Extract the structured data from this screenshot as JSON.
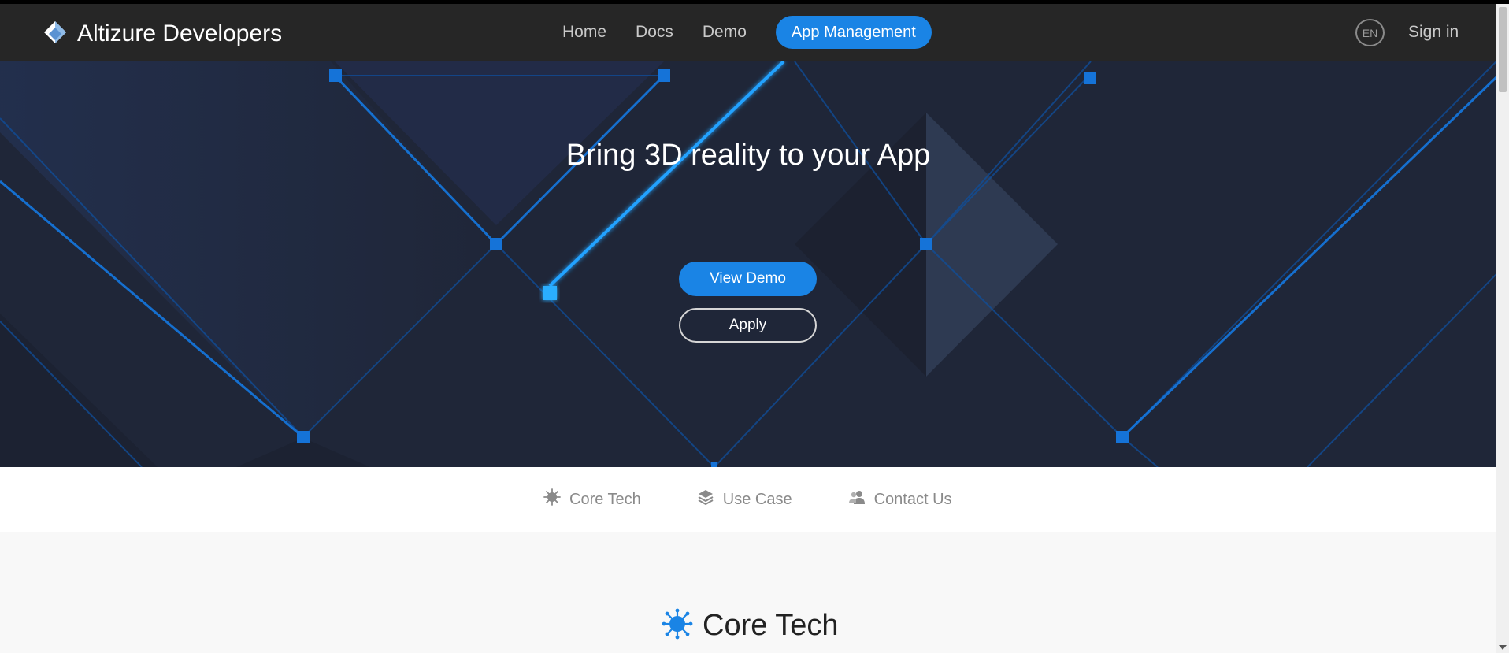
{
  "navbar": {
    "brand": "Altizure Developers",
    "links": [
      "Home",
      "Docs",
      "Demo"
    ],
    "app_management": "App Management",
    "lang": "EN",
    "sign_in": "Sign in"
  },
  "hero": {
    "title": "Bring 3D reality to your App",
    "view_demo": "View Demo",
    "apply": "Apply"
  },
  "subnav": {
    "items": [
      {
        "label": "Core Tech",
        "icon": "virus-icon"
      },
      {
        "label": "Use Case",
        "icon": "layers-icon"
      },
      {
        "label": "Contact Us",
        "icon": "users-icon"
      }
    ]
  },
  "section": {
    "title": "Core Tech",
    "icon": "virus-icon"
  },
  "colors": {
    "accent": "#1a84e5",
    "navbar": "#262626",
    "hero_bg": "#1f2638"
  }
}
